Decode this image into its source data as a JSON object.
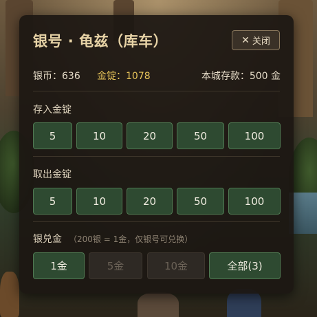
{
  "dialog": {
    "title": "银号 · 龟兹（库车）",
    "close_label": "关闭"
  },
  "status": {
    "silver_label": "银币：",
    "silver_value": "636",
    "gold_label": "金锭：",
    "gold_value": "1078",
    "deposit_label": "本城存款：",
    "deposit_value": "500 金"
  },
  "deposit_section": {
    "label": "存入金锭",
    "amounts": [
      "5",
      "10",
      "20",
      "50",
      "100"
    ]
  },
  "withdraw_section": {
    "label": "取出金锭",
    "amounts": [
      "5",
      "10",
      "20",
      "50",
      "100"
    ]
  },
  "exchange_section": {
    "label": "银兑金",
    "hint": "（200银 = 1金，仅银号可兑换）",
    "options": [
      {
        "label": "1金",
        "enabled": true
      },
      {
        "label": "5金",
        "enabled": false
      },
      {
        "label": "10金",
        "enabled": false
      },
      {
        "label": "全部(3)",
        "enabled": true
      }
    ]
  },
  "colors": {
    "panel_bg": "#1c1712",
    "gold_text": "#e9c65a",
    "button_green": "#2e4a31",
    "button_disabled": "#2e2924"
  },
  "icons": {
    "close": "close-icon"
  }
}
